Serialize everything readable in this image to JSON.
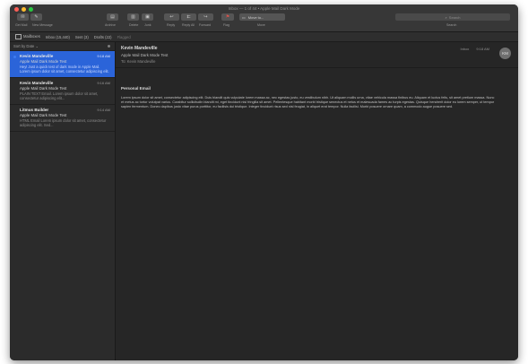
{
  "window": {
    "title": "Inbox — 1 of 44 • Apple Mail Dark Mode"
  },
  "toolbar": {
    "buttons": [
      {
        "label": "Get Mail",
        "icon": "envelope-icon"
      },
      {
        "label": "New Message",
        "icon": "compose-icon"
      },
      {
        "label": "Archive",
        "icon": "archive-icon"
      },
      {
        "label": "Delete",
        "icon": "trash-icon"
      },
      {
        "label": "Junk",
        "icon": "junk-icon"
      },
      {
        "label": "Reply",
        "icon": "reply-icon"
      },
      {
        "label": "Reply All",
        "icon": "reply-all-icon"
      },
      {
        "label": "Forward",
        "icon": "forward-icon"
      },
      {
        "label": "Flag",
        "icon": "flag-icon"
      },
      {
        "label": "Move",
        "icon": "move-icon"
      }
    ],
    "move_value": "Move to...",
    "search_placeholder": "Search",
    "search_label": "Search"
  },
  "favorites": {
    "items": [
      {
        "label": "Mailboxes"
      },
      {
        "label": "Inbox (15,440)"
      },
      {
        "label": "Sent (3)"
      },
      {
        "label": "Drafts (22)"
      },
      {
        "label": "Flagged"
      }
    ]
  },
  "list": {
    "sort_label": "Sort by Date ⌄",
    "messages": [
      {
        "from": "Kevin Mandeville",
        "time": "9:18 AM",
        "subject": "Apple Mail Dark Mode Test",
        "preview": "Hey! Just a quick test of dark mode in Apple Mail. Lorem ipsum dolor sit amet, consectetur adipiscing elit.",
        "selected": true,
        "unread": true
      },
      {
        "from": "Kevin Mandeville",
        "time": "9:16 AM",
        "subject": "Apple Mail Dark Mode Test",
        "preview": "PLAIN TEXT Email. Lorem ipsum dolor sit amet, consectetur adipiscing elit...",
        "selected": false,
        "unread": false
      },
      {
        "from": "Litmus Builder",
        "time": "9:14 AM",
        "subject": "Apple Mail Dark Mode Test",
        "preview": "HTML Email Lorem ipsum dolor sit amet, consectetur adipiscing elit. Sed...",
        "selected": false,
        "unread": false
      }
    ]
  },
  "reader": {
    "from": "Kevin Mandeville",
    "subject": "Apple Mail Dark Mode Test",
    "to": "To: Kevin Mandeville",
    "mailbox": "Inbox",
    "time": "9:18 AM",
    "avatar_initials": "KM",
    "body_title": "Personal Email",
    "body": "Lorem ipsum dolor sit amet, consectetur adipiscing elit. Duis blandit quis vulputate lorem massa ac, nec egestas justo, eu vestibulum nibh. Ut aliquam mollis urna, vitae vehicula massa finibus eu. Aliquam et luctus felis, sit amet pretium massa. Nunc et metus ac tortor volutpat varius. Curabitur sollicitudin blandit mi, eget tincidunt nisl fringilla sit amet. Pellentesque habitant morbi tristique senectus et netus et malesuada fames ac turpis egestas. Quisque hendrerit dolor eu lorem semper, ut tempor sapien fermentum. Donec dapibus justo vitae purus porttitor, eu facilisis dui tristique. Integer tincidunt risus sed nisl feugiat, in aliquet erat tempor. Nulla facilisi. Morbi posuere ornare quam, a commodo augue posuere sed."
  },
  "colors": {
    "selection": "#2b64d9",
    "background": "#262626",
    "toolbar": "#373737"
  }
}
